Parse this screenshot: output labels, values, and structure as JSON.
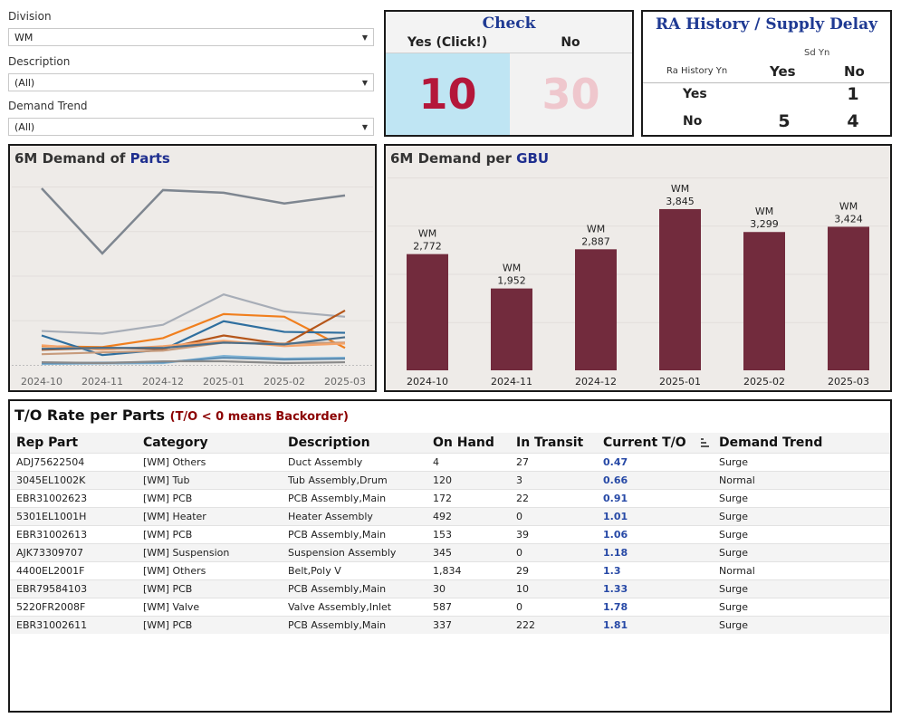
{
  "filters": [
    {
      "label": "Division",
      "value": "WM"
    },
    {
      "label": "Description",
      "value": "(All)"
    },
    {
      "label": "Demand Trend",
      "value": "(All)"
    }
  ],
  "check": {
    "title": "Check",
    "yes_label": "Yes (Click!)",
    "no_label": "No",
    "yes_value": "10",
    "no_value": "30"
  },
  "ra_history": {
    "title": "RA History / Supply Delay",
    "col_header": "Sd Yn",
    "row_header": "Ra History Yn",
    "cols": [
      "Yes",
      "No"
    ],
    "rows": [
      {
        "label": "Yes",
        "values": [
          "",
          "1"
        ]
      },
      {
        "label": "No",
        "values": [
          "5",
          "4"
        ]
      }
    ]
  },
  "colors": {
    "bar": "#722b3d",
    "panel_bg": "#eeebe8",
    "title_accent": "#1f2f8f",
    "check_yes_bg": "#bfe5f3",
    "check_yes_text": "#b4173a",
    "check_no_text": "#efc7cd",
    "to_value": "#2749a6",
    "backorder_note": "#8b0000"
  },
  "parts_chart": {
    "title_prefix": "6M Demand of ",
    "title_accent": "Parts"
  },
  "gbu_chart": {
    "title_prefix": "6M Demand per ",
    "title_accent": "GBU"
  },
  "chart_data": [
    {
      "type": "line",
      "title": "6M Demand of Parts",
      "categories": [
        "2024-10",
        "2024-11",
        "2024-12",
        "2025-01",
        "2025-02",
        "2025-03"
      ],
      "ylim": [
        0,
        1000
      ],
      "grid": true,
      "series": [
        {
          "color": "#7e8690",
          "values": [
            990,
            625,
            980,
            965,
            905,
            950
          ]
        },
        {
          "color": "#a7adb7",
          "values": [
            190,
            175,
            225,
            395,
            300,
            270
          ]
        },
        {
          "color": "#f07f1e",
          "values": [
            105,
            100,
            150,
            285,
            270,
            95
          ]
        },
        {
          "color": "#2f6f9f",
          "values": [
            165,
            55,
            85,
            245,
            185,
            180
          ]
        },
        {
          "color": "#b5561a",
          "values": [
            85,
            95,
            90,
            165,
            115,
            305
          ]
        },
        {
          "color": "#c79b7c",
          "values": [
            60,
            70,
            80,
            125,
            120,
            125
          ]
        },
        {
          "color": "#f4a36a",
          "values": [
            110,
            85,
            105,
            135,
            105,
            120
          ]
        },
        {
          "color": "#4a6e8a",
          "values": [
            90,
            95,
            95,
            125,
            115,
            155
          ]
        },
        {
          "color": "#7fb3d5",
          "values": [
            5,
            8,
            10,
            50,
            35,
            40
          ]
        },
        {
          "color": "#5f8fb4",
          "values": [
            10,
            12,
            15,
            40,
            30,
            35
          ]
        },
        {
          "color": "#8a8a8a",
          "values": [
            15,
            10,
            20,
            20,
            10,
            15
          ]
        }
      ]
    },
    {
      "type": "bar",
      "title": "6M Demand per GBU",
      "categories": [
        "2024-10",
        "2024-11",
        "2024-12",
        "2025-01",
        "2025-02",
        "2025-03"
      ],
      "series": [
        {
          "name": "WM",
          "values": [
            2772,
            1952,
            2887,
            3845,
            3299,
            3424
          ]
        }
      ],
      "value_labels": [
        "2,772",
        "1,952",
        "2,887",
        "3,845",
        "3,299",
        "3,424"
      ],
      "ylim": [
        0,
        4600
      ],
      "grid": true
    }
  ],
  "table": {
    "title": "T/O Rate per Parts",
    "note": "(T/O < 0 means Backorder)",
    "headers": [
      "Rep Part",
      "Category",
      "Description",
      "On Hand",
      "In Transit",
      "Current T/O",
      "Demand Trend"
    ],
    "rows": [
      [
        "ADJ75622504",
        "[WM] Others",
        "Duct Assembly",
        "4",
        "27",
        "0.47",
        "Surge"
      ],
      [
        "3045EL1002K",
        "[WM] Tub",
        "Tub Assembly,Drum",
        "120",
        "3",
        "0.66",
        "Normal"
      ],
      [
        "EBR31002623",
        "[WM] PCB",
        "PCB Assembly,Main",
        "172",
        "22",
        "0.91",
        "Surge"
      ],
      [
        "5301EL1001H",
        "[WM] Heater",
        "Heater Assembly",
        "492",
        "0",
        "1.01",
        "Surge"
      ],
      [
        "EBR31002613",
        "[WM] PCB",
        "PCB Assembly,Main",
        "153",
        "39",
        "1.06",
        "Surge"
      ],
      [
        "AJK73309707",
        "[WM] Suspension",
        "Suspension Assembly",
        "345",
        "0",
        "1.18",
        "Surge"
      ],
      [
        "4400EL2001F",
        "[WM] Others",
        "Belt,Poly V",
        "1,834",
        "29",
        "1.3",
        "Normal"
      ],
      [
        "EBR79584103",
        "[WM] PCB",
        "PCB Assembly,Main",
        "30",
        "10",
        "1.33",
        "Surge"
      ],
      [
        "5220FR2008F",
        "[WM] Valve",
        "Valve Assembly,Inlet",
        "587",
        "0",
        "1.78",
        "Surge"
      ],
      [
        "EBR31002611",
        "[WM] PCB",
        "PCB Assembly,Main",
        "337",
        "222",
        "1.81",
        "Surge"
      ]
    ]
  }
}
